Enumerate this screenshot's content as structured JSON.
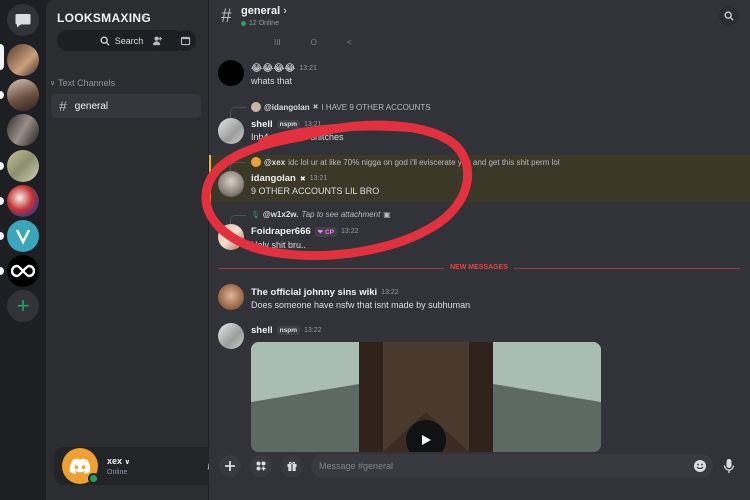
{
  "server": {
    "name": "LOOKSMAXING",
    "search_label": "Search",
    "category": "Text Channels",
    "channel": "general"
  },
  "user": {
    "name": "xex",
    "status": "Online",
    "notifications": "2"
  },
  "header": {
    "channel": "general",
    "online": "12 Online",
    "hints": [
      "III",
      "O",
      "<"
    ]
  },
  "messages": [
    {
      "id": "m1",
      "text": "😂😂😂😂",
      "time": "13:21",
      "text2": "whats that"
    },
    {
      "id": "m2",
      "reply_author": "@idangolan",
      "reply_text": "I HAVE 9 OTHER ACCOUNTS",
      "author": "shell",
      "tag": "nspm",
      "time": "13:21",
      "text": "Inb4 someone snitches"
    },
    {
      "id": "m3",
      "reply_author": "@xex",
      "reply_text": "idc lol ur at like 70% nigga on god i'll eviscerate you and get this shit perm lol",
      "author": "idangolan",
      "time": "13:21",
      "text": "9 OTHER ACCOUNTS LIL BRO"
    },
    {
      "id": "m4",
      "reply_author": "@w1x2w.",
      "reply_text": "Tap to see attachment",
      "author": "Foidraper666",
      "tag": "CP",
      "time": "13:22",
      "text": "Holy shit bru.."
    },
    {
      "id": "m5",
      "author": "The official johnny sins wiki",
      "time": "13:22",
      "text": "Does someone have nsfw that isnt made by subhuman"
    },
    {
      "id": "m6",
      "author": "shell",
      "tag": "nspm",
      "time": "13:22"
    }
  ],
  "divider": "NEW MESSAGES",
  "composer": {
    "placeholder": "Message #general"
  },
  "colors": {
    "accent_red": "#f23f43",
    "online_green": "#23a559",
    "highlight": "#f0b232",
    "ink": "#e3303f"
  },
  "icons": [
    "discord-logo-icon",
    "search-icon",
    "add-member-icon",
    "calendar-icon",
    "hash-icon",
    "bell-icon",
    "plus-icon",
    "apps-icon",
    "gift-icon",
    "emoji-icon",
    "mic-icon",
    "play-icon"
  ]
}
